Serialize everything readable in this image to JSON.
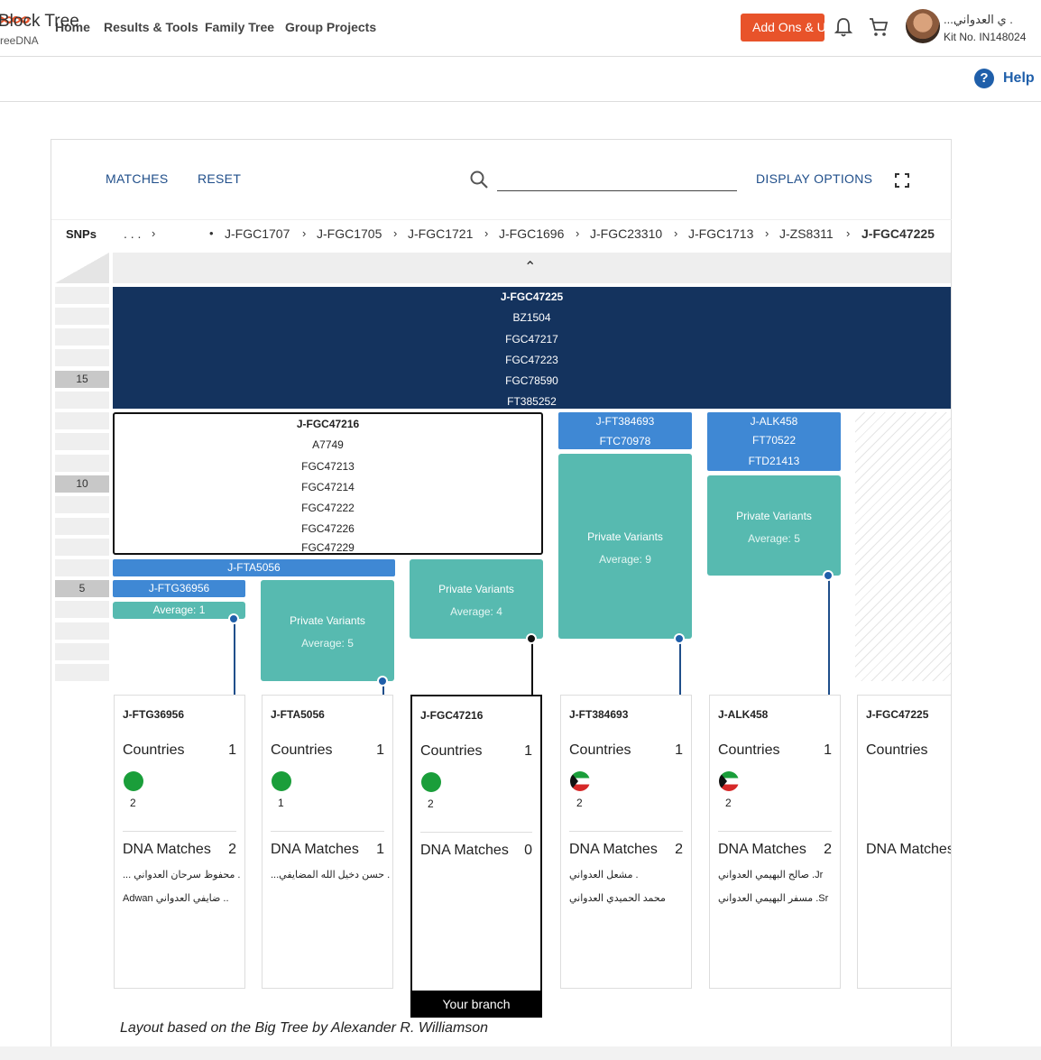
{
  "header": {
    "logo_text": "reeDNA",
    "nav": [
      "Home",
      "Results & Tools",
      "Family Tree",
      "Group Projects"
    ],
    "add_ons": "Add Ons & Up",
    "user_name": "...ي العدواني .",
    "kit": "Kit No. IN148024"
  },
  "page": {
    "title": "Block Tree",
    "help": "Help"
  },
  "toolbar": {
    "matches": "MATCHES",
    "reset": "RESET",
    "display_options": "DISPLAY OPTIONS",
    "search_value": ""
  },
  "breadcrumb": {
    "label": "SNPs",
    "ellipsis": ". . .",
    "items": [
      "J-FGC1707",
      "J-FGC1705",
      "J-FGC1721",
      "J-FGC1696",
      "J-FGC23310",
      "J-FGC1713",
      "J-ZS8311",
      "J-FGC47225"
    ]
  },
  "ruler": [
    "15",
    "10",
    "5"
  ],
  "blocks": {
    "top": [
      "J-FGC47225",
      "BZ1504",
      "FGC47217",
      "FGC47223",
      "FGC78590",
      "FT385252"
    ],
    "fgc47216": [
      "J-FGC47216",
      "A7749",
      "FGC47213",
      "FGC47214",
      "FGC47222",
      "FGC47226",
      "FGC47229"
    ],
    "ft384693": [
      "J-FT384693",
      "FTC70978"
    ],
    "alk458": [
      "J-ALK458",
      "FT70522",
      "FTD21413"
    ],
    "fta5056": "J-FTA5056",
    "ftg36956": "J-FTG36956",
    "ftg_avg": "Average: 1"
  },
  "private_variants": [
    {
      "label": "Private Variants",
      "avg": "Average: 5"
    },
    {
      "label": "Private Variants",
      "avg": "Average: 4"
    },
    {
      "label": "Private Variants",
      "avg": "Average: 9"
    },
    {
      "label": "Private Variants",
      "avg": "Average: 5"
    }
  ],
  "cards": [
    {
      "title": "J-FTG36956",
      "countries_label": "Countries",
      "countries": "1",
      "flag_count": "2",
      "matches_label": "DNA Matches",
      "matches": "2",
      "m1": "... محفوظ سرحان العدواني .",
      "m2": "Adwan ضايفي العدواني .."
    },
    {
      "title": "J-FTA5056",
      "countries_label": "Countries",
      "countries": "1",
      "flag_count": "1",
      "matches_label": "DNA Matches",
      "matches": "1",
      "m1": "...حسن دخيل الله المضايفي .",
      "m2": ""
    },
    {
      "title": "J-FGC47216",
      "countries_label": "Countries",
      "countries": "1",
      "flag_count": "2",
      "matches_label": "DNA Matches",
      "matches": "0",
      "m1": "",
      "m2": ""
    },
    {
      "title": "J-FT384693",
      "countries_label": "Countries",
      "countries": "1",
      "flag_count": "2",
      "matches_label": "DNA Matches",
      "matches": "2",
      "m1": "مشعل العدواني .",
      "m2": "محمد الحميدي العدواني"
    },
    {
      "title": "J-ALK458",
      "countries_label": "Countries",
      "countries": "1",
      "flag_count": "2",
      "matches_label": "DNA Matches",
      "matches": "2",
      "m1": "صالح البهيمي العدواني .Jr",
      "m2": "مسفر البهيمي العدواني .Sr"
    },
    {
      "title": "J-FGC47225",
      "countries_label": "Countries",
      "countries": "",
      "flag_count": "",
      "matches_label": "DNA Matches",
      "matches": "",
      "m1": "",
      "m2": ""
    }
  ],
  "your_branch": "Your branch",
  "footnote": "Layout based on the Big Tree by Alexander R. Williamson",
  "colors": {
    "dark_block": "#14335e",
    "mid_block": "#3f88d4",
    "teal": "#57bab0",
    "accent": "#e8532a",
    "link": "#1f4e8a"
  }
}
